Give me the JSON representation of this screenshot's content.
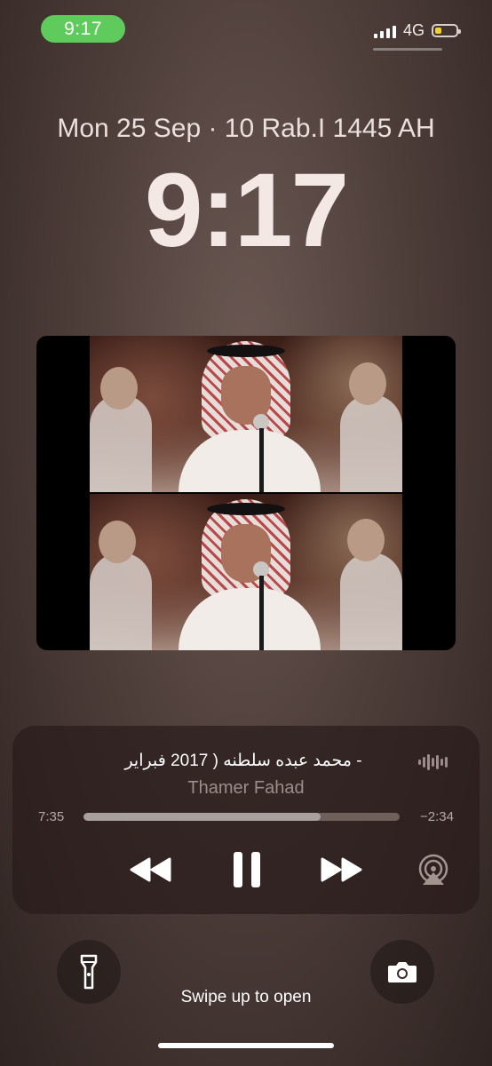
{
  "status_bar": {
    "time": "9:17",
    "network": "4G",
    "battery_level": 0.3,
    "battery_color": "#f3cf2f",
    "pill_color": "#5ecb5c"
  },
  "lock_screen": {
    "date": "Mon 25 Sep · 10 Rab.I 1445 AH",
    "time": "9:17"
  },
  "now_playing": {
    "title": "- محمد عبده      سلطنه ( 2017 فبراير",
    "artist": "Thamer Fahad",
    "elapsed": "7:35",
    "remaining": "−2:34",
    "progress": 0.75,
    "icons": [
      "waveform-icon",
      "rewind-icon",
      "pause-icon",
      "fast-forward-icon",
      "airplay-icon"
    ]
  },
  "bottom": {
    "hint": "Swipe up to open",
    "icons": [
      "flashlight-icon",
      "camera-icon"
    ]
  }
}
